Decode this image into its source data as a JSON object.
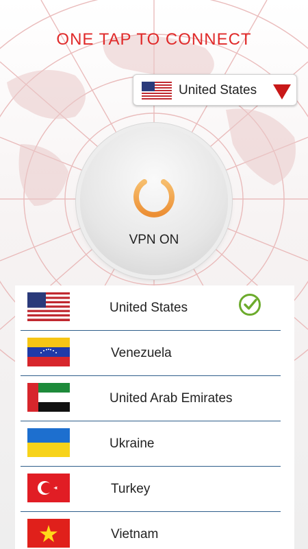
{
  "header": {
    "title": "ONE TAP TO CONNECT"
  },
  "selector": {
    "country": "United States",
    "flag": "us-flag"
  },
  "power": {
    "status": "VPN ON"
  },
  "servers": [
    {
      "name": "United States",
      "flag": "us-flag",
      "selected": true
    },
    {
      "name": "Venezuela",
      "flag": "venezuela-flag",
      "selected": false
    },
    {
      "name": "United Arab Emirates",
      "flag": "uae-flag",
      "selected": false
    },
    {
      "name": "Ukraine",
      "flag": "ukraine-flag",
      "selected": false
    },
    {
      "name": "Turkey",
      "flag": "turkey-flag",
      "selected": false
    },
    {
      "name": "Vietnam",
      "flag": "vietnam-flag",
      "selected": false
    }
  ],
  "colors": {
    "accent": "#e02a2a",
    "check": "#6cab2c",
    "power": "#f0a24a",
    "divider": "#2d5d8a"
  }
}
